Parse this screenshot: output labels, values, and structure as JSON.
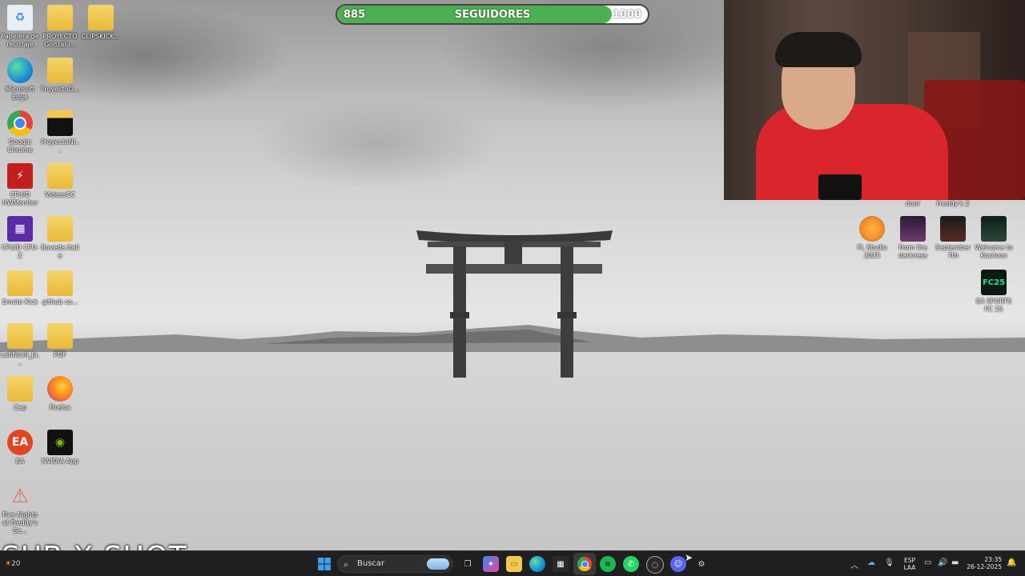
{
  "desktop": {
    "left_icons": [
      {
        "label": "Papelera de reciclaje",
        "icon": "recycle-bin-icon"
      },
      {
        "label": "PROYECTO Gonzalo...",
        "icon": "folder-icon"
      },
      {
        "label": "CLIPSKICK...",
        "icon": "folder-icon"
      },
      {
        "label": "Microsoft Edge",
        "icon": "edge-icon"
      },
      {
        "label": "ProyectoG...",
        "icon": "folder-icon"
      },
      {
        "label": "Google Chrome",
        "icon": "chrome-icon"
      },
      {
        "label": "ProyectoNi...",
        "icon": "folder-icon"
      },
      {
        "label": "CPUID HWMonitor",
        "icon": "hwmonitor-icon"
      },
      {
        "label": "VideosCC",
        "icon": "folder-icon"
      },
      {
        "label": "CPUID CPU-Z",
        "icon": "cpuz-icon"
      },
      {
        "label": "Boveda.Italia",
        "icon": "folder-icon"
      },
      {
        "label": "Emote Kick",
        "icon": "folder-icon"
      },
      {
        "label": "github co...",
        "icon": "folder-icon"
      },
      {
        "label": "LabNovil_Ja...",
        "icon": "folder-icon"
      },
      {
        "label": "PDF",
        "icon": "folder-icon"
      },
      {
        "label": "Cap",
        "icon": "folder-icon"
      },
      {
        "label": "Firefox",
        "icon": "firefox-icon"
      },
      {
        "label": "EA",
        "icon": "ea-icon"
      },
      {
        "label": "NVIDIA App",
        "icon": "nvidia-icon"
      },
      {
        "label": "Five Nights at Freddy's Se...",
        "icon": "fnaf-icon"
      }
    ],
    "right_icons": [
      {
        "label": "door",
        "icon": "game-icon"
      },
      {
        "label": "Freddy's 2",
        "icon": "game-icon"
      },
      {
        "label": "FL Studio 2025",
        "icon": "flstudio-icon"
      },
      {
        "label": "From the darkness",
        "icon": "game-icon"
      },
      {
        "label": "September 7th",
        "icon": "game-icon"
      },
      {
        "label": "Welcome to Kowloon",
        "icon": "game-icon"
      },
      {
        "label": "EA SPORTS FC 25",
        "icon": "fc25-icon"
      }
    ]
  },
  "followers": {
    "current": "885",
    "label": "SEGUIDORES",
    "goal": "1000",
    "progress": 0.885
  },
  "overlay": {
    "text": "SUB X SHOT"
  },
  "taskbar": {
    "search_placeholder": "Buscar",
    "tray": {
      "lang1": "ESP",
      "lang2": "LAA",
      "time": "23:35",
      "date": "26-12-2025"
    },
    "weather_fragment": "20"
  },
  "colors": {
    "progress_fill": "#4caf50",
    "taskbar": "#1f1f1f"
  }
}
